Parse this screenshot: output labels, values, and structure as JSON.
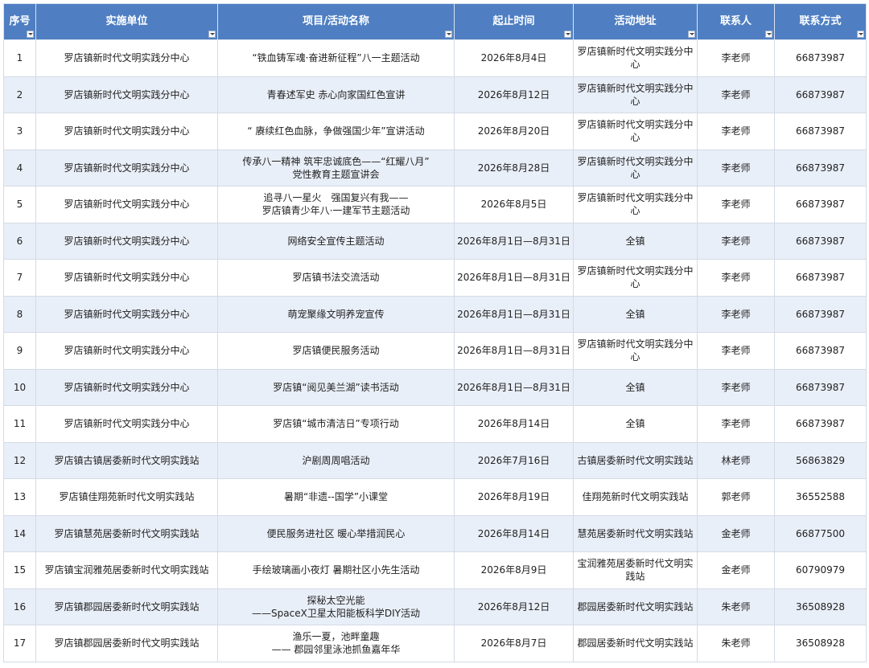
{
  "headers": [
    "序号",
    "实施单位",
    "项目/活动名称",
    "起止时间",
    "活动地址",
    "联系人",
    "联系方式"
  ],
  "rows": [
    [
      "1",
      "罗店镇新时代文明实践分中心",
      "“铁血铸军魂·奋进新征程”八一主题活动",
      "2026年8月4日",
      "罗店镇新时代文明实践分中心",
      "李老师",
      "66873987"
    ],
    [
      "2",
      "罗店镇新时代文明实践分中心",
      "青春述军史 赤心向家国红色宣讲",
      "2026年8月12日",
      "罗店镇新时代文明实践分中心",
      "李老师",
      "66873987"
    ],
    [
      "3",
      "罗店镇新时代文明实践分中心",
      "“ 赓续红色血脉，争做强国少年”宣讲活动",
      "2026年8月20日",
      "罗店镇新时代文明实践分中心",
      "李老师",
      "66873987"
    ],
    [
      "4",
      "罗店镇新时代文明实践分中心",
      "传承八一精神 筑牢忠诚底色——“红耀八月”\n党性教育主题宣讲会",
      "2026年8月28日",
      "罗店镇新时代文明实践分中心",
      "李老师",
      "66873987"
    ],
    [
      "5",
      "罗店镇新时代文明实践分中心",
      "追寻八一星火　强国复兴有我——\n罗店镇青少年八·一建军节主题活动",
      "2026年8月5日",
      "罗店镇新时代文明实践分中心",
      "李老师",
      "66873987"
    ],
    [
      "6",
      "罗店镇新时代文明实践分中心",
      "网络安全宣传主题活动",
      "2026年8月1日—8月31日",
      "全镇",
      "李老师",
      "66873987"
    ],
    [
      "7",
      "罗店镇新时代文明实践分中心",
      "罗店镇书法交流活动",
      "2026年8月1日—8月31日",
      "罗店镇新时代文明实践分中心",
      "李老师",
      "66873987"
    ],
    [
      "8",
      "罗店镇新时代文明实践分中心",
      "萌宠聚缘文明养宠宣传",
      "2026年8月1日—8月31日",
      "全镇",
      "李老师",
      "66873987"
    ],
    [
      "9",
      "罗店镇新时代文明实践分中心",
      "罗店镇便民服务活动",
      "2026年8月1日—8月31日",
      "罗店镇新时代文明实践分中心",
      "李老师",
      "66873987"
    ],
    [
      "10",
      "罗店镇新时代文明实践分中心",
      "罗店镇“阅见美兰湖”读书活动",
      "2026年8月1日—8月31日",
      "全镇",
      "李老师",
      "66873987"
    ],
    [
      "11",
      "罗店镇新时代文明实践分中心",
      "罗店镇“城市清洁日”专项行动",
      "2026年8月14日",
      "全镇",
      "李老师",
      "66873987"
    ],
    [
      "12",
      "罗店镇古镇居委新时代文明实践站",
      "沪剧周周唱活动",
      "2026年7月16日",
      "古镇居委新时代文明实践站",
      "林老师",
      "56863829"
    ],
    [
      "13",
      "罗店镇佳翔苑新时代文明实践站",
      "暑期“非遗--国学”小课堂",
      "2026年8月19日",
      "佳翔苑新时代文明实践站",
      "郭老师",
      "36552588"
    ],
    [
      "14",
      "罗店镇慧苑居委新时代文明实践站",
      "便民服务进社区 暖心举措润民心",
      "2026年8月14日",
      "慧苑居委新时代文明实践站",
      "金老师",
      "66877500"
    ],
    [
      "15",
      "罗店镇宝润雅苑居委新时代文明实践站",
      "手绘玻璃画小夜灯 暑期社区小先生活动",
      "2026年8月9日",
      "宝润雅苑居委新时代文明实践站",
      "金老师",
      "60790979"
    ],
    [
      "16",
      "罗店镇郡园居委新时代文明实践站",
      "探秘太空光能\n——SpaceX卫星太阳能板科学DIY活动",
      "2026年8月12日",
      "郡园居委新时代文明实践站",
      "朱老师",
      "36508928"
    ],
    [
      "17",
      "罗店镇郡园居委新时代文明实践站",
      "渔乐一夏，池畔童趣\n—— 郡园邻里泳池抓鱼嘉年华",
      "2026年8月7日",
      "郡园居委新时代文明实践站",
      "朱老师",
      "36508928"
    ]
  ]
}
